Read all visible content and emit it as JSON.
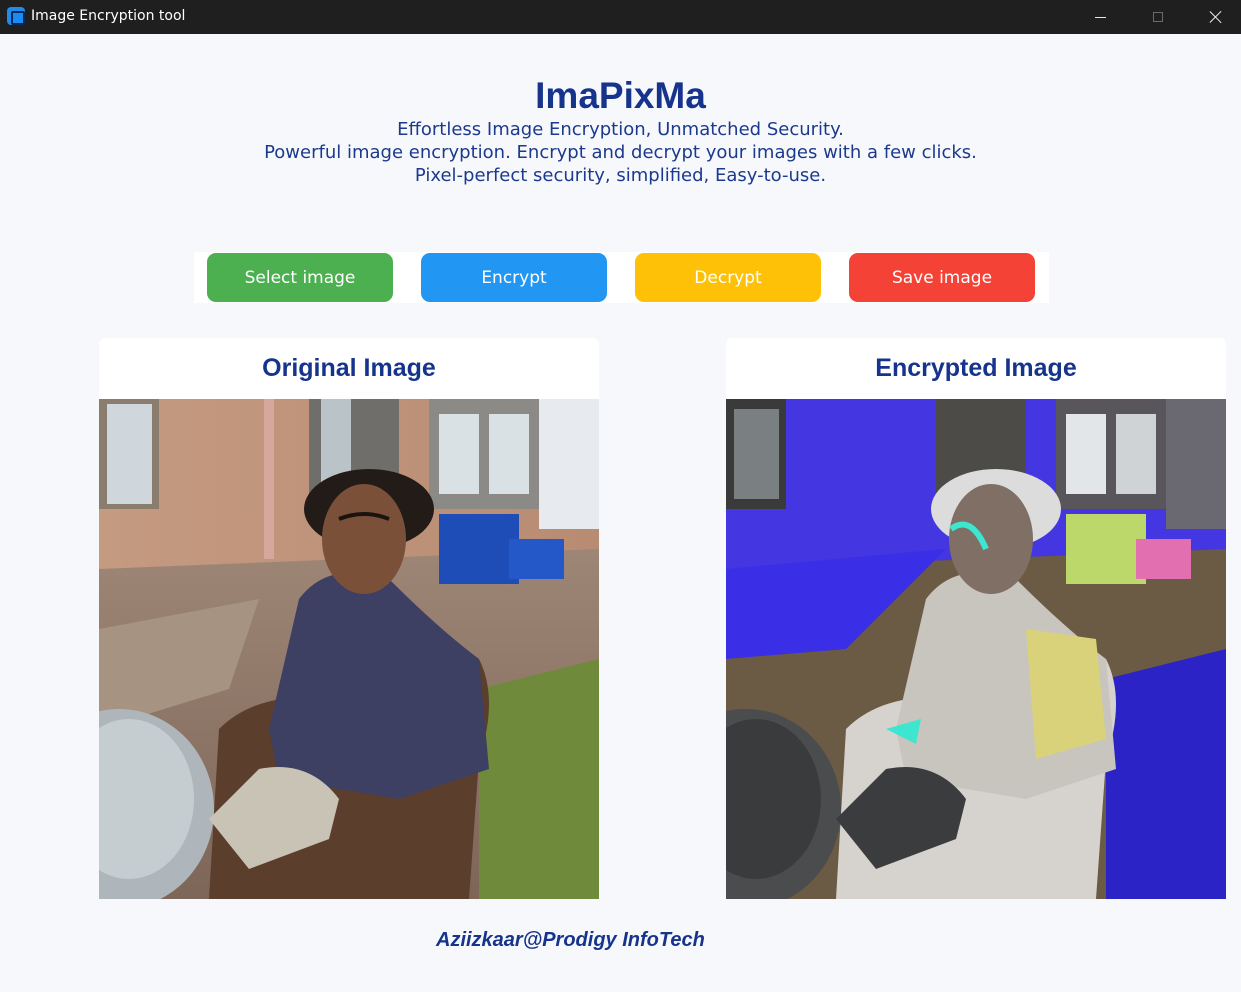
{
  "window": {
    "title": "Image Encryption tool",
    "controls": [
      "minimize-icon",
      "maximize-icon",
      "close-icon"
    ]
  },
  "header": {
    "app_name": "ImaPixMa",
    "taglines": [
      "Effortless Image Encryption, Unmatched Security.",
      "Powerful image encryption. Encrypt and decrypt your images with a few clicks.",
      "Pixel-perfect security, simplified, Easy-to-use."
    ]
  },
  "toolbar": {
    "select_label": "Select image",
    "encrypt_label": "Encrypt",
    "decrypt_label": "Decrypt",
    "save_label": "Save image"
  },
  "panels": {
    "original": {
      "title": "Original Image"
    },
    "encrypted": {
      "title": "Encrypted Image"
    }
  },
  "footer": {
    "credit": "Aziizkaar@Prodigy InfoTech"
  },
  "colors": {
    "accent": "#16348c",
    "select": "#4caf50",
    "encrypt": "#2196f3",
    "decrypt": "#ffc107",
    "save": "#f44336"
  }
}
